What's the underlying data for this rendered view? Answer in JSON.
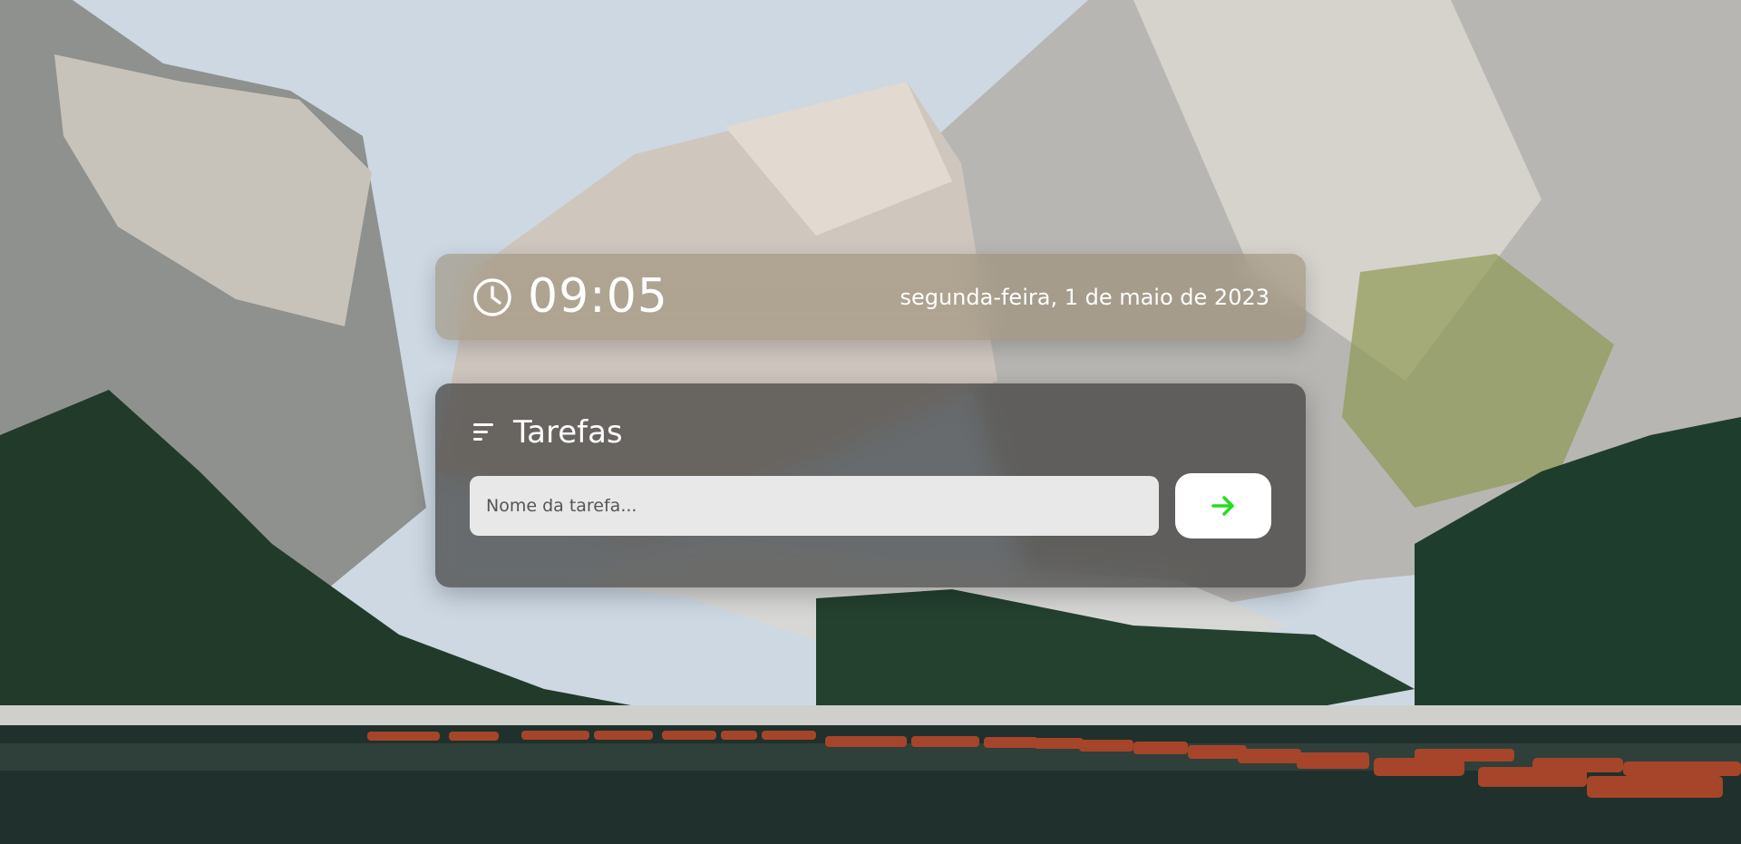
{
  "clock": {
    "icon": "clock-icon",
    "time": "09:05",
    "date": "segunda-feira, 1 de maio de 2023"
  },
  "tasks": {
    "icon": "sort-lines-icon",
    "title": "Tarefas",
    "input_placeholder": "Nome da tarefa...",
    "input_value": "",
    "add_button_icon": "arrow-right-icon",
    "accent_color": "#22dd22"
  },
  "background": {
    "description_icon": "mountain-lake-landscape"
  }
}
